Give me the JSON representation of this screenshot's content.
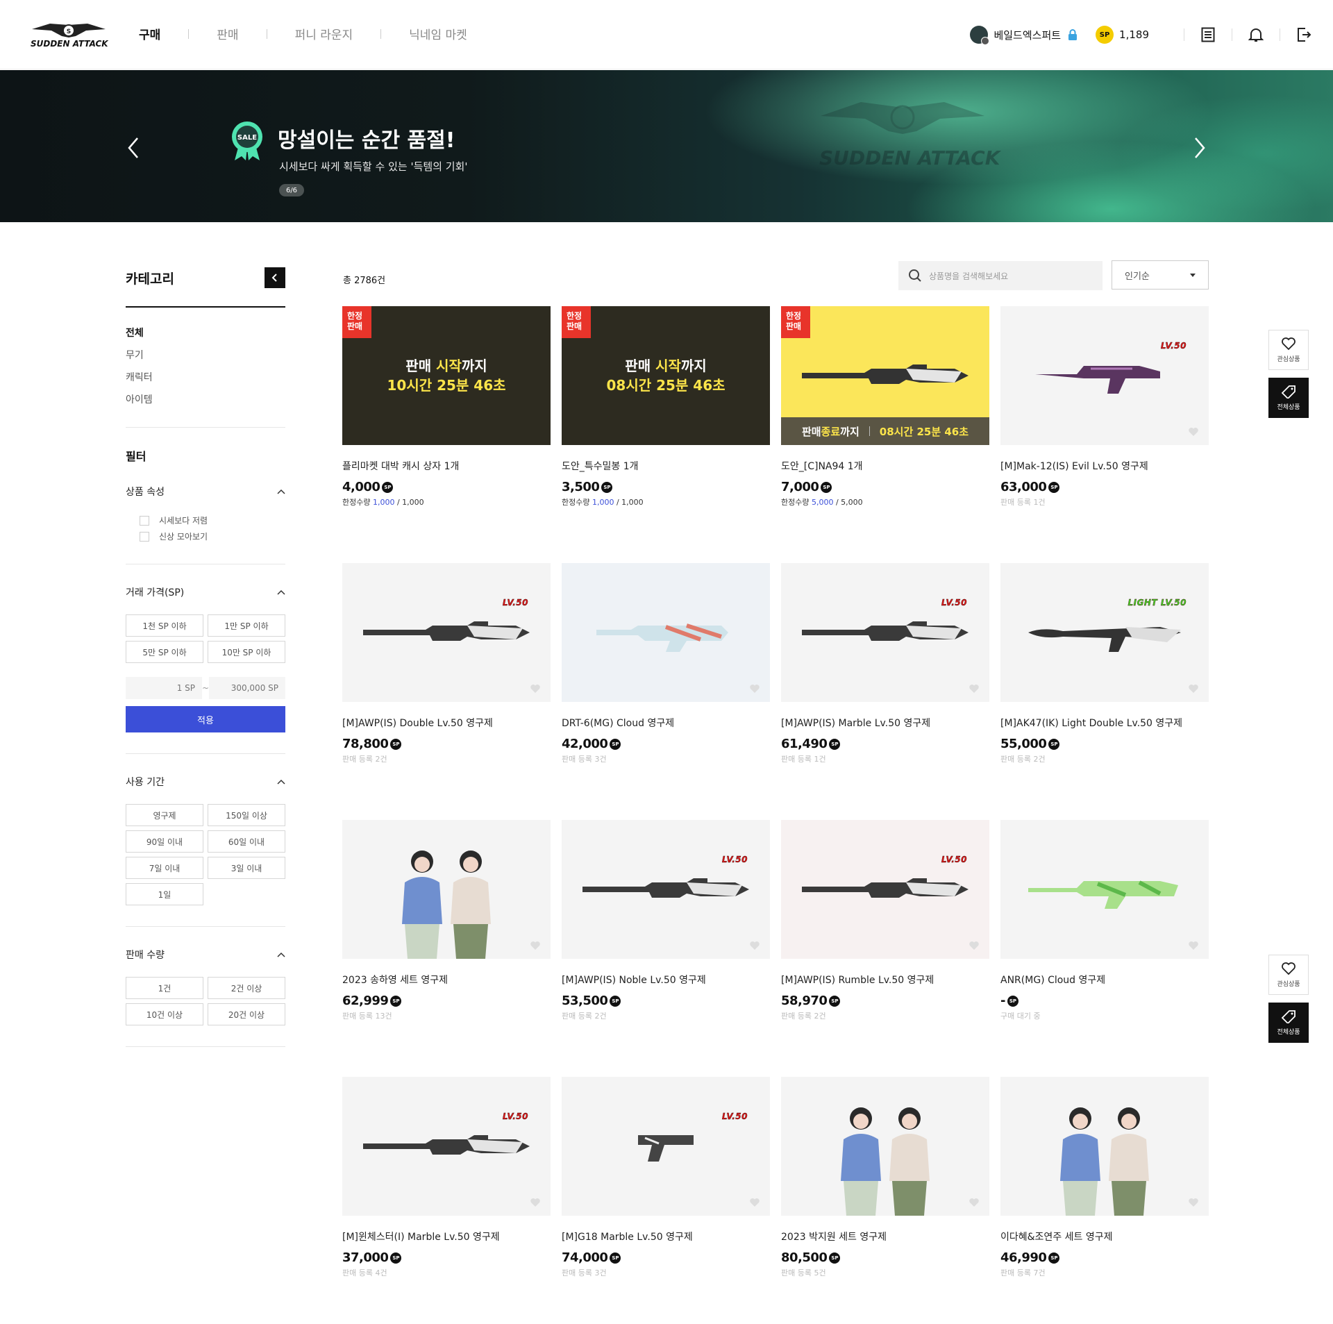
{
  "header": {
    "logo_text": "SUDDEN ATTACK",
    "nav": [
      {
        "label": "구매",
        "active": true
      },
      {
        "label": "판매",
        "active": false
      },
      {
        "label": "퍼니 라운지",
        "active": false
      },
      {
        "label": "닉네임 마켓",
        "active": false
      }
    ],
    "user_name": "베일드엑스퍼트",
    "sp_badge": "SP",
    "sp_amount": "1,189"
  },
  "banner": {
    "badge": "SALE",
    "title": "망설이는 순간 품절!",
    "subtitle": "시세보다 싸게 획득할 수 있는 '득템의 기회'",
    "pager": "6/6",
    "watermark": "SUDDEN ATTACK"
  },
  "sidebar": {
    "category_title": "카테고리",
    "categories": [
      "전체",
      "무기",
      "캐릭터",
      "아이템"
    ],
    "filter_title": "필터",
    "attr_title": "상품 속성",
    "attr_options": [
      "시세보다 저렴",
      "신상 모아보기"
    ],
    "price_title": "거래 가격(SP)",
    "price_options": [
      "1천 SP 이하",
      "1만 SP 이하",
      "5만 SP 이하",
      "10만 SP 이하"
    ],
    "price_min_placeholder": "1 SP",
    "price_sep": "~",
    "price_max_placeholder": "300,000 SP",
    "apply_label": "적용",
    "period_title": "사용 기간",
    "period_options": [
      "영구제",
      "150일 이상",
      "90일 이내",
      "60일 이내",
      "7일 이내",
      "3일 이내",
      "1일"
    ],
    "qty_title": "판매 수량",
    "qty_options": [
      "1건",
      "2건 이상",
      "10건 이상",
      "20건 이상"
    ]
  },
  "toolbar": {
    "total": "총 2786건",
    "search_placeholder": "상품명을 검색해보세요",
    "sort_label": "인기순"
  },
  "limited_label": [
    "한정",
    "판매"
  ],
  "sale_text": {
    "pre": "판매 ",
    "hl": "시작",
    "post": "까지",
    "end_pre": "판매 ",
    "end_hl": "종료",
    "end_post": "까지"
  },
  "sp_mark": "SP",
  "products": [
    {
      "name": "플리마켓 대박 캐시 상자 1개",
      "price": "4,000",
      "limited": true,
      "timer": "10시간 25분 46초",
      "meta_pre": "한정수량 ",
      "meta_hl": "1,000",
      "meta_post": " / 1,000",
      "thumb": "dark"
    },
    {
      "name": "도안_특수밀봉 1개",
      "price": "3,500",
      "limited": true,
      "timer": "08시간 25분 46초",
      "meta_pre": "한정수량 ",
      "meta_hl": "1,000",
      "meta_post": " / 1,000",
      "thumb": "dark"
    },
    {
      "name": "도안_[C]NA94 1개",
      "price": "7,000",
      "limited": true,
      "timer": "08시간 25분 46초",
      "meta_pre": "한정수량 ",
      "meta_hl": "5,000",
      "meta_post": " / 5,000",
      "thumb": "yellow"
    },
    {
      "name": "[M]Mak-12(IS) Evil Lv.50 영구제",
      "price": "63,000",
      "meta": "판매 등록 1건",
      "level": "LV.50",
      "thumb": "gun-purple"
    },
    {
      "name": "[M]AWP(IS) Double Lv.50 영구제",
      "price": "78,800",
      "meta": "판매 등록 2건",
      "level": "LV.50",
      "thumb": "rifle"
    },
    {
      "name": "DRT-6(MG) Cloud 영구제",
      "price": "42,000",
      "meta": "판매 등록 3건",
      "thumb": "blue"
    },
    {
      "name": "[M]AWP(IS) Marble Lv.50 영구제",
      "price": "61,490",
      "meta": "판매 등록 1건",
      "level": "LV.50",
      "thumb": "rifle"
    },
    {
      "name": "[M]AK47(IK) Light Double Lv.50 영구제",
      "price": "55,000",
      "meta": "판매 등록 2건",
      "level": "LIGHT LV.50",
      "thumb": "ak"
    },
    {
      "name": "2023 송하영 세트 영구제",
      "price": "62,999",
      "meta": "판매 등록 13건",
      "thumb": "figs"
    },
    {
      "name": "[M]AWP(IS) Noble Lv.50 영구제",
      "price": "53,500",
      "meta": "판매 등록 2건",
      "level": "LV.50",
      "thumb": "rifle"
    },
    {
      "name": "[M]AWP(IS) Rumble Lv.50 영구제",
      "price": "58,970",
      "meta": "판매 등록 2건",
      "level": "LV.50",
      "thumb": "rifle-pink"
    },
    {
      "name": "ANR(MG) Cloud 영구제",
      "price": "-",
      "meta": "구매 대기 중",
      "thumb": "green-gun"
    },
    {
      "name": "[M]윈체스터(I) Marble Lv.50 영구제",
      "price": "37,000",
      "meta": "판매 등록 4건",
      "level": "LV.50",
      "thumb": "rifle"
    },
    {
      "name": "[M]G18 Marble Lv.50 영구제",
      "price": "74,000",
      "meta": "판매 등록 3건",
      "level": "LV.50",
      "thumb": "pistol"
    },
    {
      "name": "2023 박지원 세트 영구제",
      "price": "80,500",
      "meta": "판매 등록 5건",
      "thumb": "figs"
    },
    {
      "name": "이다혜&조연주 세트 영구제",
      "price": "46,990",
      "meta": "판매 등록 7건",
      "thumb": "figs"
    }
  ],
  "float": {
    "wish_label": "관심상품",
    "all_label": "전체상품"
  }
}
